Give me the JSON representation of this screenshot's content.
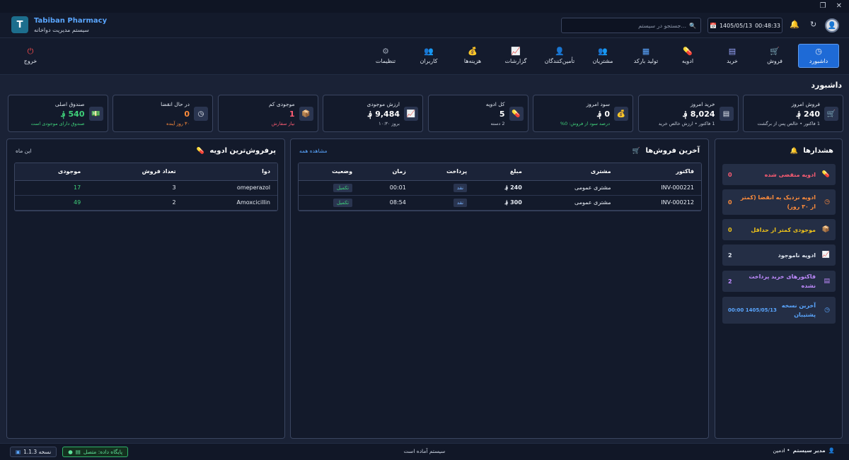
{
  "app": {
    "name": "Tabiban Pharmacy",
    "subtitle": "سیستم مدیریت دواخانه",
    "logo_letter": "T"
  },
  "header": {
    "search_placeholder": "جستجو در سیستم...",
    "date": "1405/05/13",
    "time": "00:48:33"
  },
  "nav": [
    {
      "label": "داشبورد",
      "icon": "clock-icon",
      "glyph": "◷",
      "color": "#e6ebf3",
      "active": true
    },
    {
      "label": "فروش",
      "icon": "cart-icon",
      "glyph": "🛒",
      "color": "#2fc489",
      "active": false
    },
    {
      "label": "خرید",
      "icon": "document-icon",
      "glyph": "▤",
      "color": "#9aa7ff",
      "active": false
    },
    {
      "label": "ادویه",
      "icon": "pill-icon",
      "glyph": "💊",
      "color": "#ff6b8a",
      "active": false
    },
    {
      "label": "تولید بارکد",
      "icon": "barcode-icon",
      "glyph": "▦",
      "color": "#5aa6ff",
      "active": false
    },
    {
      "label": "مشتریان",
      "icon": "people-icon",
      "glyph": "👥",
      "color": "#f0b429",
      "active": false
    },
    {
      "label": "تأمین‌کنندگان",
      "icon": "supplier-icon",
      "glyph": "👤",
      "color": "#f0b429",
      "active": false
    },
    {
      "label": "گزارشات",
      "icon": "chart-icon",
      "glyph": "📈",
      "color": "#3fb0ff",
      "active": false
    },
    {
      "label": "هزینه‌ها",
      "icon": "money-bag-icon",
      "glyph": "💰",
      "color": "#3fd17a",
      "active": false
    },
    {
      "label": "کاربران",
      "icon": "users-icon",
      "glyph": "👥",
      "color": "#f0b429",
      "active": false
    },
    {
      "label": "تنظیمات",
      "icon": "gear-icon",
      "glyph": "⚙",
      "color": "#9aa3b3",
      "active": false
    }
  ],
  "logout_label": "خروج",
  "page_title": "داشبورد",
  "cards": [
    {
      "label": "فروش امروز",
      "value": "240 ؋",
      "sub": "1 فاکتور • خالص پس از برگشت",
      "icon": "cart-icon",
      "glyph": "🛒",
      "color": "#fff",
      "sub_color": "#c3cad7"
    },
    {
      "label": "خرید امروز",
      "value": "8,024 ؋",
      "sub": "1 فاکتور • ارزش خالص خرید",
      "icon": "document-icon",
      "glyph": "▤",
      "color": "#fff",
      "sub_color": "#c3cad7"
    },
    {
      "label": "سود امروز",
      "value": "0 ؋",
      "sub": "درصد سود از فروش: 0%",
      "icon": "money-bag-icon",
      "glyph": "💰",
      "color": "#fff",
      "sub_color": "#3fd17a"
    },
    {
      "label": "کل ادویه",
      "value": "5",
      "sub": "2 دسته",
      "icon": "pill-icon",
      "glyph": "💊",
      "color": "#fff",
      "sub_color": "#c3cad7"
    },
    {
      "label": "ارزش موجودی",
      "value": "9,484 ؋",
      "sub": "بروز ۱۰:۳۰",
      "icon": "chart-icon",
      "glyph": "📈",
      "color": "#fff",
      "sub_color": "#c3cad7"
    },
    {
      "label": "موجودی کم",
      "value": "1",
      "sub": "نیاز سفارش",
      "icon": "box-icon",
      "glyph": "📦",
      "color": "#ff5d73",
      "sub_color": "#ff5d73"
    },
    {
      "label": "در حال انقضا",
      "value": "0",
      "sub": "۳۰ روز آینده",
      "icon": "clock-icon",
      "glyph": "◷",
      "color": "#ff8c3b",
      "sub_color": "#ff8c3b"
    },
    {
      "label": "صندوق اصلی",
      "value": "540 ؋",
      "sub": "صندوق دارای موجودی است",
      "icon": "cash-icon",
      "glyph": "💵",
      "color": "#3fd17a",
      "sub_color": "#3fd17a"
    }
  ],
  "alerts": {
    "title": "هشدارها",
    "items": [
      {
        "text": "ادویه منقضی شده",
        "count": "0",
        "color": "#ff5d73",
        "icon": "pill-icon",
        "glyph": "💊"
      },
      {
        "text": "ادویه نزدیک به انقضا (کمتر از ۳۰ روز)",
        "count": "0",
        "color": "#ff8c3b",
        "icon": "clock-icon",
        "glyph": "◷"
      },
      {
        "text": "موجودی کمتر از حداقل",
        "count": "0",
        "color": "#f0c419",
        "icon": "box-icon",
        "glyph": "📦"
      },
      {
        "text": "ادویه ناموجود",
        "count": "2",
        "color": "#dfe5ee",
        "icon": "chart-icon",
        "glyph": "📈"
      },
      {
        "text": "فاکتورهای خرید پرداخت نشده",
        "count": "2",
        "color": "#c08bff",
        "icon": "document-icon",
        "glyph": "▤"
      },
      {
        "text": "آخرین نسخه پشتیبان",
        "count": "1405/05/13 00:00",
        "color": "#5aa6ff",
        "icon": "clock-icon",
        "glyph": "◷"
      }
    ]
  },
  "sales": {
    "title": "آخرین فروش‌ها",
    "view_all": "مشاهده همه",
    "columns": [
      "فاکتور",
      "مشتری",
      "مبلغ",
      "پرداخت",
      "زمان",
      "وضعیت"
    ],
    "rows": [
      {
        "invoice": "INV-000221",
        "customer": "مشتری عمومی",
        "amount": "240 ؋",
        "payment": "نقد",
        "time": "00:01",
        "status": "تکمیل"
      },
      {
        "invoice": "INV-000212",
        "customer": "مشتری عمومی",
        "amount": "300 ؋",
        "payment": "نقد",
        "time": "08:54",
        "status": "تکمیل"
      }
    ]
  },
  "top_drugs": {
    "title": "پرفروش‌ترین ادویه",
    "period": "این ماه",
    "columns": [
      "دوا",
      "تعداد فروش",
      "موجودی"
    ],
    "rows": [
      {
        "name": "omeperazol",
        "sold": "3",
        "stock": "17"
      },
      {
        "name": "Amoxcicillin",
        "sold": "2",
        "stock": "49"
      }
    ]
  },
  "status": {
    "version": "نسخه 1.1.3",
    "db": "پایگاه داده: متصل",
    "message": "سیستم آماده است",
    "user": "مدیر سیستم",
    "role": "• ادمین"
  }
}
